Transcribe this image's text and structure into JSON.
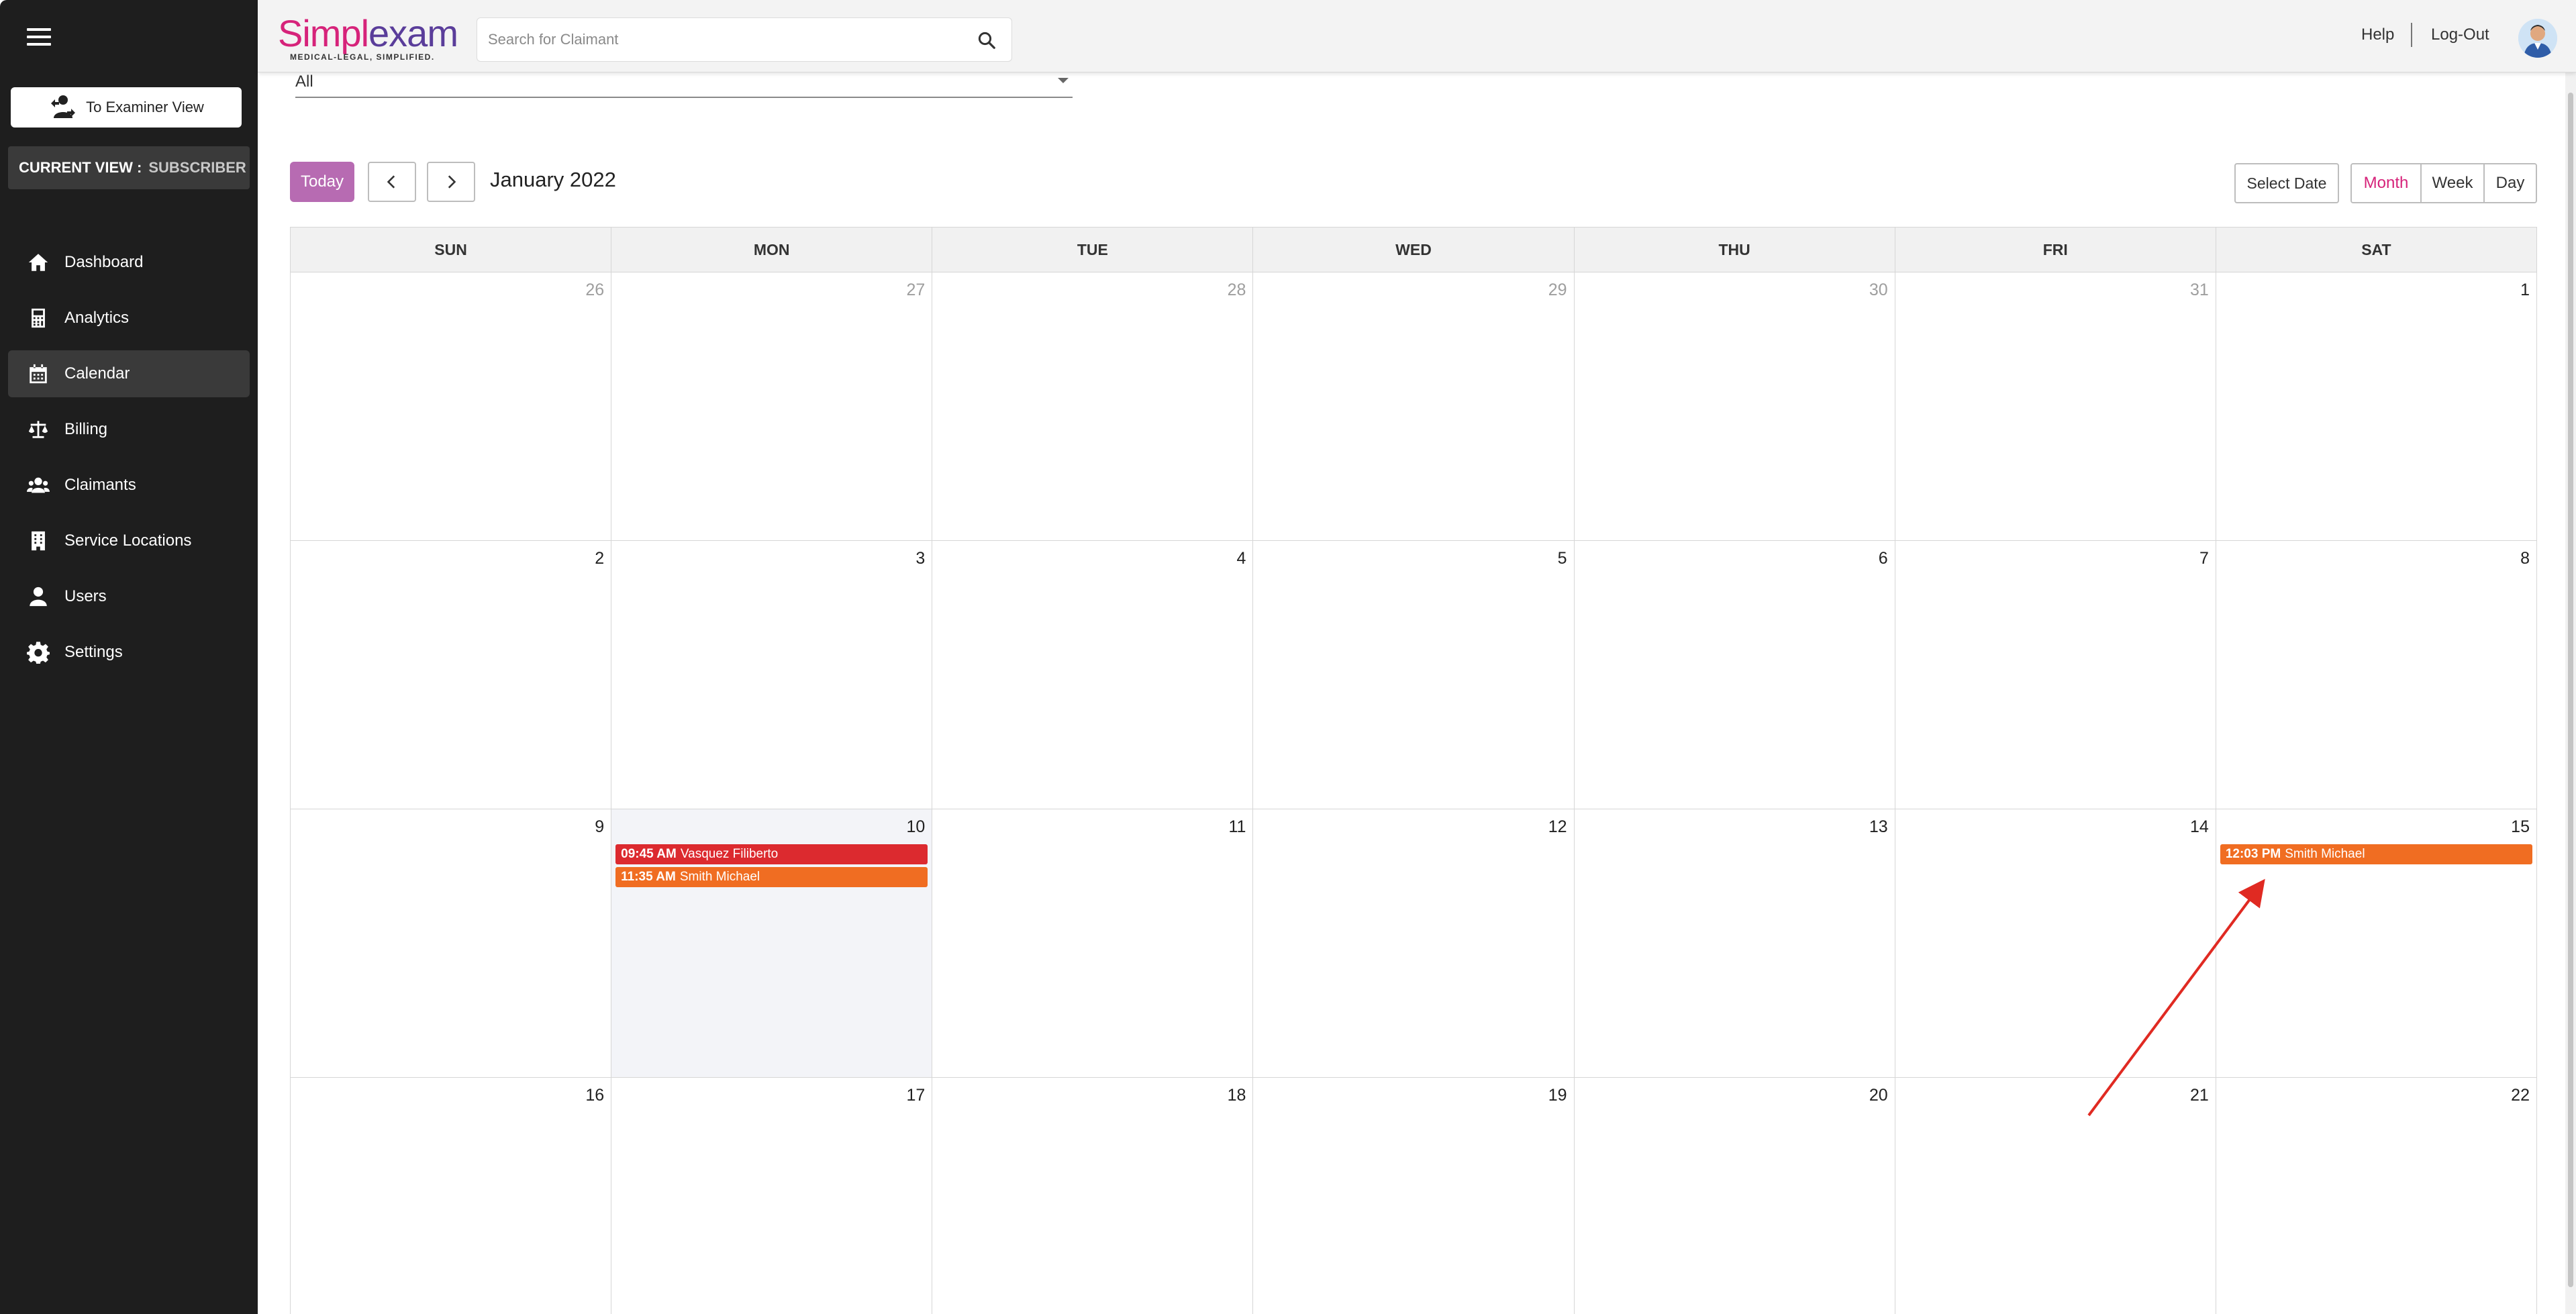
{
  "app": {
    "logo_text_a": "Simpl",
    "logo_text_b": "exam",
    "logo_tagline": "MEDICAL-LEGAL, SIMPLIFIED.",
    "brand_pink": "#d6237a",
    "brand_purple": "#5a3d9a"
  },
  "sidebar": {
    "examiner_button": "To Examiner View",
    "current_view_label": "CURRENT VIEW :",
    "current_view_value": "SUBSCRIBER",
    "items": [
      {
        "label": "Dashboard",
        "icon": "home-icon"
      },
      {
        "label": "Analytics",
        "icon": "calculator-icon"
      },
      {
        "label": "Calendar",
        "icon": "calendar-icon",
        "active": true
      },
      {
        "label": "Billing",
        "icon": "scale-icon"
      },
      {
        "label": "Claimants",
        "icon": "users-icon"
      },
      {
        "label": "Service Locations",
        "icon": "building-icon"
      },
      {
        "label": "Users",
        "icon": "user-icon"
      },
      {
        "label": "Settings",
        "icon": "gear-icon"
      }
    ]
  },
  "header": {
    "search_placeholder": "Search for Claimant",
    "help": "Help",
    "logout": "Log-Out"
  },
  "filter": {
    "value": "All"
  },
  "toolbar": {
    "today": "Today",
    "title": "January 2022",
    "select_date": "Select Date",
    "views": [
      "Month",
      "Week",
      "Day"
    ],
    "active_view": "Month"
  },
  "calendar": {
    "weekdays": [
      "SUN",
      "MON",
      "TUE",
      "WED",
      "THU",
      "FRI",
      "SAT"
    ],
    "weeks": [
      [
        {
          "day": "26",
          "muted": true
        },
        {
          "day": "27",
          "muted": true
        },
        {
          "day": "28",
          "muted": true
        },
        {
          "day": "29",
          "muted": true
        },
        {
          "day": "30",
          "muted": true
        },
        {
          "day": "31",
          "muted": true
        },
        {
          "day": "1"
        }
      ],
      [
        {
          "day": "2"
        },
        {
          "day": "3"
        },
        {
          "day": "4"
        },
        {
          "day": "5"
        },
        {
          "day": "6"
        },
        {
          "day": "7"
        },
        {
          "day": "8"
        }
      ],
      [
        {
          "day": "9"
        },
        {
          "day": "10",
          "today": true,
          "events": [
            {
              "time": "09:45 AM",
              "name": "Vasquez Filiberto",
              "color": "#dc2a2f"
            },
            {
              "time": "11:35 AM",
              "name": "Smith Michael",
              "color": "#f06d22"
            }
          ]
        },
        {
          "day": "11"
        },
        {
          "day": "12"
        },
        {
          "day": "13"
        },
        {
          "day": "14"
        },
        {
          "day": "15",
          "events": [
            {
              "time": "12:03 PM",
              "name": "Smith Michael",
              "color": "#f06d22"
            }
          ]
        }
      ],
      [
        {
          "day": "16"
        },
        {
          "day": "17"
        },
        {
          "day": "18"
        },
        {
          "day": "19"
        },
        {
          "day": "20"
        },
        {
          "day": "21"
        },
        {
          "day": "22"
        }
      ]
    ]
  }
}
